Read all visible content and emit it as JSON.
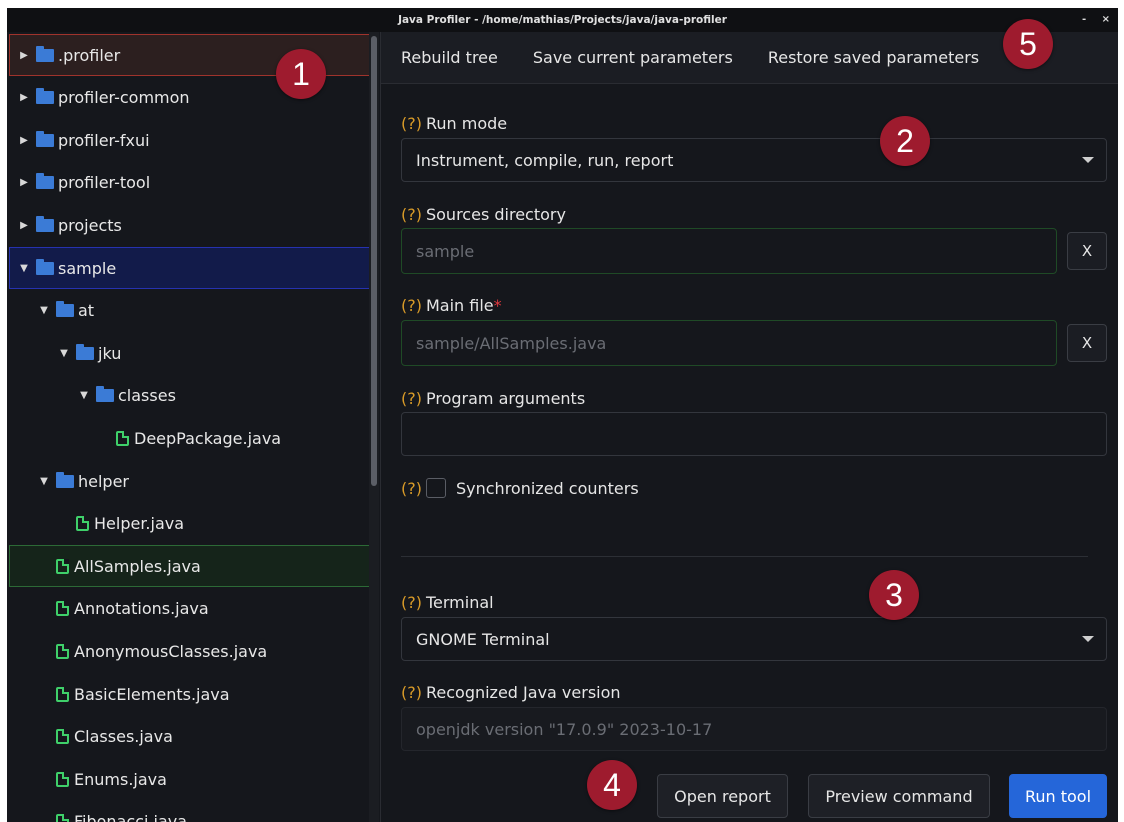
{
  "window": {
    "title": "Java Profiler - /home/mathias/Projects/java/java-profiler",
    "minimize": "-",
    "close": "×"
  },
  "tree": [
    {
      "label": ".profiler",
      "kind": "folder",
      "expanded": false,
      "depth": 0,
      "highlight": "red"
    },
    {
      "label": "profiler-common",
      "kind": "folder",
      "expanded": false,
      "depth": 0
    },
    {
      "label": "profiler-fxui",
      "kind": "folder",
      "expanded": false,
      "depth": 0
    },
    {
      "label": "profiler-tool",
      "kind": "folder",
      "expanded": false,
      "depth": 0
    },
    {
      "label": "projects",
      "kind": "folder",
      "expanded": false,
      "depth": 0
    },
    {
      "label": "sample",
      "kind": "folder",
      "expanded": true,
      "depth": 0,
      "highlight": "blue"
    },
    {
      "label": "at",
      "kind": "folder",
      "expanded": true,
      "depth": 1
    },
    {
      "label": "jku",
      "kind": "folder",
      "expanded": true,
      "depth": 2
    },
    {
      "label": "classes",
      "kind": "folder",
      "expanded": true,
      "depth": 3
    },
    {
      "label": "DeepPackage.java",
      "kind": "file",
      "depth": 4
    },
    {
      "label": "helper",
      "kind": "folder",
      "expanded": true,
      "depth": 1
    },
    {
      "label": "Helper.java",
      "kind": "file",
      "depth": 2
    },
    {
      "label": "AllSamples.java",
      "kind": "file",
      "depth": 1,
      "highlight": "green"
    },
    {
      "label": "Annotations.java",
      "kind": "file",
      "depth": 1
    },
    {
      "label": "AnonymousClasses.java",
      "kind": "file",
      "depth": 1
    },
    {
      "label": "BasicElements.java",
      "kind": "file",
      "depth": 1
    },
    {
      "label": "Classes.java",
      "kind": "file",
      "depth": 1
    },
    {
      "label": "Enums.java",
      "kind": "file",
      "depth": 1
    },
    {
      "label": "Fibonacci.java",
      "kind": "file",
      "depth": 1
    }
  ],
  "toolbar": {
    "rebuild": "Rebuild tree",
    "save": "Save current parameters",
    "restore": "Restore saved parameters"
  },
  "form": {
    "help": "(?)",
    "required_mark": "*",
    "run_mode_label": "Run mode",
    "run_mode_value": "Instrument, compile, run, report",
    "sources_label": "Sources directory",
    "sources_value": "sample",
    "clear": "X",
    "main_label": "Main file",
    "main_value": "sample/AllSamples.java",
    "args_label": "Program arguments",
    "args_value": "",
    "sync_label": "Synchronized counters",
    "terminal_label": "Terminal",
    "terminal_value": "GNOME Terminal",
    "java_label": "Recognized Java version",
    "java_value": "openjdk version \"17.0.9\" 2023-10-17"
  },
  "actions": {
    "open_report": "Open report",
    "preview": "Preview command",
    "run": "Run tool"
  },
  "badges": [
    "1",
    "2",
    "3",
    "4",
    "5"
  ],
  "colors": {
    "accent": "#2566d9",
    "badge": "#9e1b2e",
    "help": "#d99b28",
    "folder": "#3b7bd6",
    "file": "#3fd06a"
  }
}
